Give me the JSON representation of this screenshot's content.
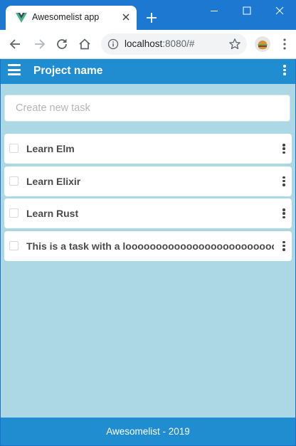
{
  "browser": {
    "tab_title": "Awesomelist app",
    "url_host": "localhost",
    "url_rest": ":8080/#",
    "favicon": "vue-logo-icon",
    "accent_color": "#1c78d0"
  },
  "app": {
    "project_name": "Project name",
    "new_task_placeholder": "Create new task",
    "new_task_value": "",
    "tasks": [
      {
        "title": "Learn Elm",
        "done": false
      },
      {
        "title": "Learn Elixir",
        "done": false
      },
      {
        "title": "Learn Rust",
        "done": false
      },
      {
        "title": "This is a task with a looooooooooooooooooooooooooooooooooooooooooooooooong title",
        "done": false
      }
    ],
    "footer": "Awesomelist - 2019",
    "header_color": "#1f8dd0",
    "background_color": "#abd8e4"
  }
}
